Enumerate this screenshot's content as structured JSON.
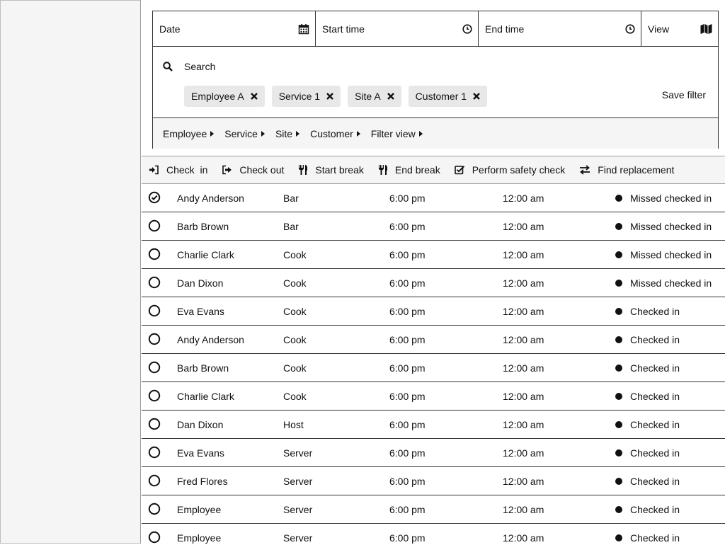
{
  "filters": {
    "date_label": "Date",
    "start_time_label": "Start time",
    "end_time_label": "End time",
    "view_label": "View",
    "search_label": "Search",
    "chips": [
      "Employee A",
      "Service 1",
      "Site A",
      "Customer 1"
    ],
    "save_filter_label": "Save filter",
    "dropdowns": [
      "Employee",
      "Service",
      "Site",
      "Customer",
      "Filter view"
    ]
  },
  "actions": [
    "Check  in",
    "Check out",
    "Start break",
    "End break",
    "Perform safety check",
    "Find replacement"
  ],
  "rows": [
    {
      "name": "Andy Anderson",
      "service": "Bar",
      "start": "6:00 pm",
      "end": "12:00 am",
      "status": "Missed checked in",
      "checked": true
    },
    {
      "name": "Barb Brown",
      "service": "Bar",
      "start": "6:00 pm",
      "end": "12:00 am",
      "status": "Missed checked in",
      "checked": false
    },
    {
      "name": "Charlie Clark",
      "service": "Cook",
      "start": "6:00 pm",
      "end": "12:00 am",
      "status": "Missed checked in",
      "checked": false
    },
    {
      "name": "Dan Dixon",
      "service": "Cook",
      "start": "6:00 pm",
      "end": "12:00 am",
      "status": "Missed checked in",
      "checked": false
    },
    {
      "name": "Eva Evans",
      "service": "Cook",
      "start": "6:00 pm",
      "end": "12:00 am",
      "status": "Checked in",
      "checked": false
    },
    {
      "name": "Andy Anderson",
      "service": "Cook",
      "start": "6:00 pm",
      "end": "12:00 am",
      "status": "Checked in",
      "checked": false
    },
    {
      "name": "Barb Brown",
      "service": "Cook",
      "start": "6:00 pm",
      "end": "12:00 am",
      "status": "Checked in",
      "checked": false
    },
    {
      "name": "Charlie Clark",
      "service": "Cook",
      "start": "6:00 pm",
      "end": "12:00 am",
      "status": "Checked in",
      "checked": false
    },
    {
      "name": "Dan Dixon",
      "service": "Host",
      "start": "6:00 pm",
      "end": "12:00 am",
      "status": "Checked in",
      "checked": false
    },
    {
      "name": "Eva Evans",
      "service": "Server",
      "start": "6:00 pm",
      "end": "12:00 am",
      "status": "Checked in",
      "checked": false
    },
    {
      "name": "Fred Flores",
      "service": "Server",
      "start": "6:00 pm",
      "end": "12:00 am",
      "status": "Checked in",
      "checked": false
    },
    {
      "name": "Employee",
      "service": "Server",
      "start": "6:00 pm",
      "end": "12:00 am",
      "status": "Checked in",
      "checked": false
    },
    {
      "name": "Employee",
      "service": "Server",
      "start": "6:00 pm",
      "end": "12:00 am",
      "status": "Checked in",
      "checked": false
    }
  ],
  "icons": {
    "date": "calendar-icon",
    "start": "clock-icon",
    "end": "clock-icon",
    "view": "map-icon",
    "search": "search-icon",
    "chip_remove": "close-icon",
    "actions": [
      "sign-in-icon",
      "sign-out-icon",
      "utensils-icon",
      "utensils-icon",
      "check-square-icon",
      "exchange-icon"
    ]
  }
}
